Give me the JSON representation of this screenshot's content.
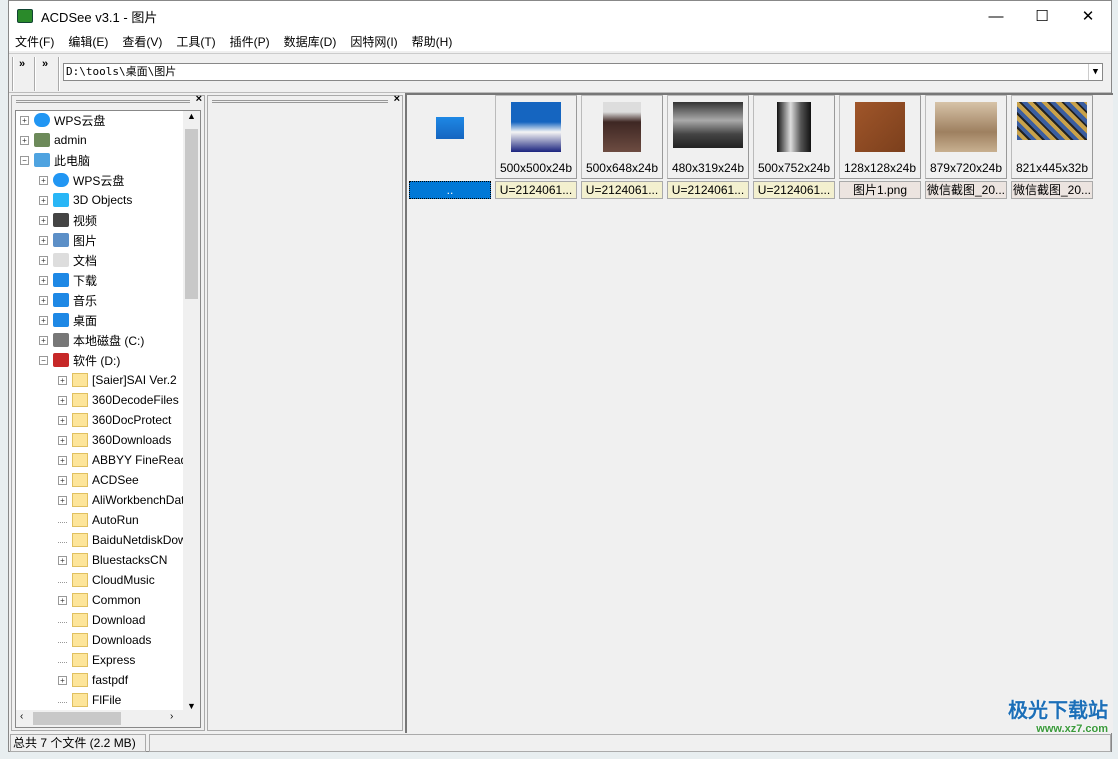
{
  "window": {
    "title": "ACDSee v3.1 - 图片",
    "min": "—",
    "max": "☐",
    "close": "✕"
  },
  "menu": [
    "文件(F)",
    "编辑(E)",
    "查看(V)",
    "工具(T)",
    "插件(P)",
    "数据库(D)",
    "因特网(I)",
    "帮助(H)"
  ],
  "toolbar": {
    "chev": "»",
    "address": "D:\\tools\\桌面\\图片",
    "dropdown": "▼"
  },
  "pane": {
    "close": "×"
  },
  "tree": [
    {
      "label": "WPS云盘",
      "level": 0,
      "icon": "cloud-icon",
      "exp": "+"
    },
    {
      "label": "admin",
      "level": 0,
      "icon": "user-icon",
      "exp": "+"
    },
    {
      "label": "此电脑",
      "level": 0,
      "icon": "computer-icon",
      "exp": "−"
    },
    {
      "label": "WPS云盘",
      "level": 1,
      "icon": "cloud-icon",
      "exp": "+"
    },
    {
      "label": "3D Objects",
      "level": 1,
      "icon": "cube-icon",
      "exp": "+"
    },
    {
      "label": "视频",
      "level": 1,
      "icon": "film-icon",
      "exp": "+"
    },
    {
      "label": "图片",
      "level": 1,
      "icon": "picture-icon",
      "exp": "+"
    },
    {
      "label": "文档",
      "level": 1,
      "icon": "document-icon",
      "exp": "+"
    },
    {
      "label": "下载",
      "level": 1,
      "icon": "download-icon",
      "exp": "+"
    },
    {
      "label": "音乐",
      "level": 1,
      "icon": "music-icon",
      "exp": "+"
    },
    {
      "label": "桌面",
      "level": 1,
      "icon": "desktop-icon",
      "exp": "+"
    },
    {
      "label": "本地磁盘 (C:)",
      "level": 1,
      "icon": "drive-icon",
      "exp": "+"
    },
    {
      "label": "软件 (D:)",
      "level": 1,
      "icon": "drive-d-icon",
      "exp": "−"
    },
    {
      "label": "[Saier]SAI Ver.2",
      "level": 2,
      "icon": "folder-icon",
      "exp": "+"
    },
    {
      "label": "360DecodeFiles",
      "level": 2,
      "icon": "folder-icon",
      "exp": "+"
    },
    {
      "label": "360DocProtect",
      "level": 2,
      "icon": "folder-icon",
      "exp": "+"
    },
    {
      "label": "360Downloads",
      "level": 2,
      "icon": "folder-icon",
      "exp": "+"
    },
    {
      "label": "ABBYY FineReader",
      "level": 2,
      "icon": "folder-icon",
      "exp": "+"
    },
    {
      "label": "ACDSee",
      "level": 2,
      "icon": "folder-icon",
      "exp": "+"
    },
    {
      "label": "AliWorkbenchData",
      "level": 2,
      "icon": "folder-icon",
      "exp": "+"
    },
    {
      "label": "AutoRun",
      "level": 2,
      "icon": "folder-icon",
      "exp": ""
    },
    {
      "label": "BaiduNetdiskDownload",
      "level": 2,
      "icon": "folder-icon",
      "exp": ""
    },
    {
      "label": "BluestacksCN",
      "level": 2,
      "icon": "folder-icon",
      "exp": "+"
    },
    {
      "label": "CloudMusic",
      "level": 2,
      "icon": "folder-icon",
      "exp": ""
    },
    {
      "label": "Common",
      "level": 2,
      "icon": "folder-icon",
      "exp": "+"
    },
    {
      "label": "Download",
      "level": 2,
      "icon": "folder-icon",
      "exp": ""
    },
    {
      "label": "Downloads",
      "level": 2,
      "icon": "folder-icon",
      "exp": ""
    },
    {
      "label": "Express",
      "level": 2,
      "icon": "folder-icon",
      "exp": ""
    },
    {
      "label": "fastpdf",
      "level": 2,
      "icon": "folder-icon",
      "exp": "+"
    },
    {
      "label": "FlFile",
      "level": 2,
      "icon": "folder-icon",
      "exp": ""
    }
  ],
  "files": [
    {
      "dim": "",
      "name": "..",
      "bg": "#0078d7",
      "img": "linear-gradient(#1e88e5,#1565c0)",
      "w": 28,
      "h": 22,
      "selected": true
    },
    {
      "dim": "500x500x24b",
      "name": "U=2124061...",
      "bg": "#f3f0cf",
      "img": "linear-gradient(#1565c0 40%,#f5f5f5 60%,#1a237e)",
      "w": 50,
      "h": 50
    },
    {
      "dim": "500x648x24b",
      "name": "U=2124061...",
      "bg": "#f3f0cf",
      "img": "linear-gradient(#ddd 20%,#3e2723 40%,#6d4c41)",
      "w": 38,
      "h": 50
    },
    {
      "dim": "480x319x24b",
      "name": "U=2124061...",
      "bg": "#f3f0cf",
      "img": "linear-gradient(#333,#aaa 40%,#444 70%,#222)",
      "w": 70,
      "h": 46
    },
    {
      "dim": "500x752x24b",
      "name": "U=2124061...",
      "bg": "#f3f0cf",
      "img": "linear-gradient(90deg,#111,#ddd 40%,#555 70%,#111)",
      "w": 34,
      "h": 50
    },
    {
      "dim": "128x128x24b",
      "name": "图片1.png",
      "bg": "#ece4e0",
      "img": "linear-gradient(135deg,#a0562a,#7b3f1c)",
      "w": 50,
      "h": 50
    },
    {
      "dim": "879x720x24b",
      "name": "微信截图_20...",
      "bg": "#ece4e0",
      "img": "linear-gradient(#d7c3a8,#9e8060 60%,#c8b090)",
      "w": 62,
      "h": 50
    },
    {
      "dim": "821x445x32b",
      "name": "微信截图_20...",
      "bg": "#ece4e0",
      "img": "repeating-linear-gradient(45deg,#3b5ea0 0 4px,#c9a24a 4px 8px,#222 8px 10px)",
      "w": 70,
      "h": 38
    }
  ],
  "status": {
    "summary": "总共 7 个文件 (2.2 MB)"
  },
  "watermark": {
    "brand": "极光下载站",
    "url": "www.xz7.com"
  }
}
